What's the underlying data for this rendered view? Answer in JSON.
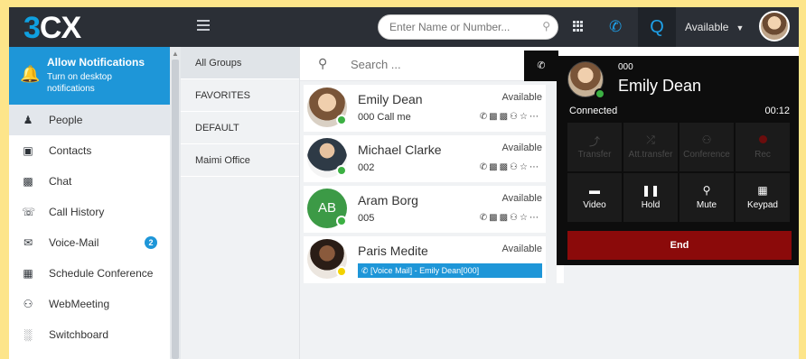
{
  "topbar": {
    "logo_num": "3",
    "logo_text": "CX",
    "search_placeholder": "Enter Name or Number...",
    "q_label": "Q",
    "status": "Available"
  },
  "sidebar": {
    "notification": {
      "title": "Allow Notifications",
      "line1": "Turn on desktop",
      "line2": "notifications"
    },
    "items": [
      {
        "label": "People",
        "icon": "person-icon"
      },
      {
        "label": "Contacts",
        "icon": "contacts-icon"
      },
      {
        "label": "Chat",
        "icon": "chat-icon"
      },
      {
        "label": "Call History",
        "icon": "phone-history-icon"
      },
      {
        "label": "Voice-Mail",
        "icon": "voicemail-icon",
        "badge": "2"
      },
      {
        "label": "Schedule Conference",
        "icon": "calendar-icon"
      },
      {
        "label": "WebMeeting",
        "icon": "group-icon"
      },
      {
        "label": "Switchboard",
        "icon": "bar-chart-icon"
      }
    ]
  },
  "groups": [
    "All Groups",
    "FAVORITES",
    "DEFAULT",
    "Maimi Office"
  ],
  "contacts_search_placeholder": "Search ...",
  "contacts": [
    {
      "name": "Emily Dean",
      "ext": "000",
      "note": "Call me",
      "status": "Available",
      "initials": "",
      "dot": "#3cb043"
    },
    {
      "name": "Michael Clarke",
      "ext": "002",
      "note": "",
      "status": "Available",
      "initials": "",
      "dot": "#3cb043"
    },
    {
      "name": "Aram Borg",
      "ext": "005",
      "note": "",
      "status": "Available",
      "initials": "AB",
      "dot": "#3cb043"
    },
    {
      "name": "Paris Medite",
      "ext": "",
      "note": "",
      "status": "Available",
      "initials": "",
      "dot": "#f2d200",
      "voicemail": "[Voice Mail] - Emily Dean[000]"
    }
  ],
  "call": {
    "number": "000",
    "name": "Emily Dean",
    "status": "Connected",
    "time": "00:12",
    "buttons_dim": [
      "Transfer",
      "Att.transfer",
      "Conference",
      "Rec"
    ],
    "buttons": [
      "Video",
      "Hold",
      "Mute",
      "Keypad"
    ],
    "end": "End"
  },
  "colors": {
    "accent": "#1e96d8",
    "topbar": "#2b2f36",
    "end": "#8b0a0a",
    "online": "#3cb043",
    "away": "#f2d200"
  }
}
